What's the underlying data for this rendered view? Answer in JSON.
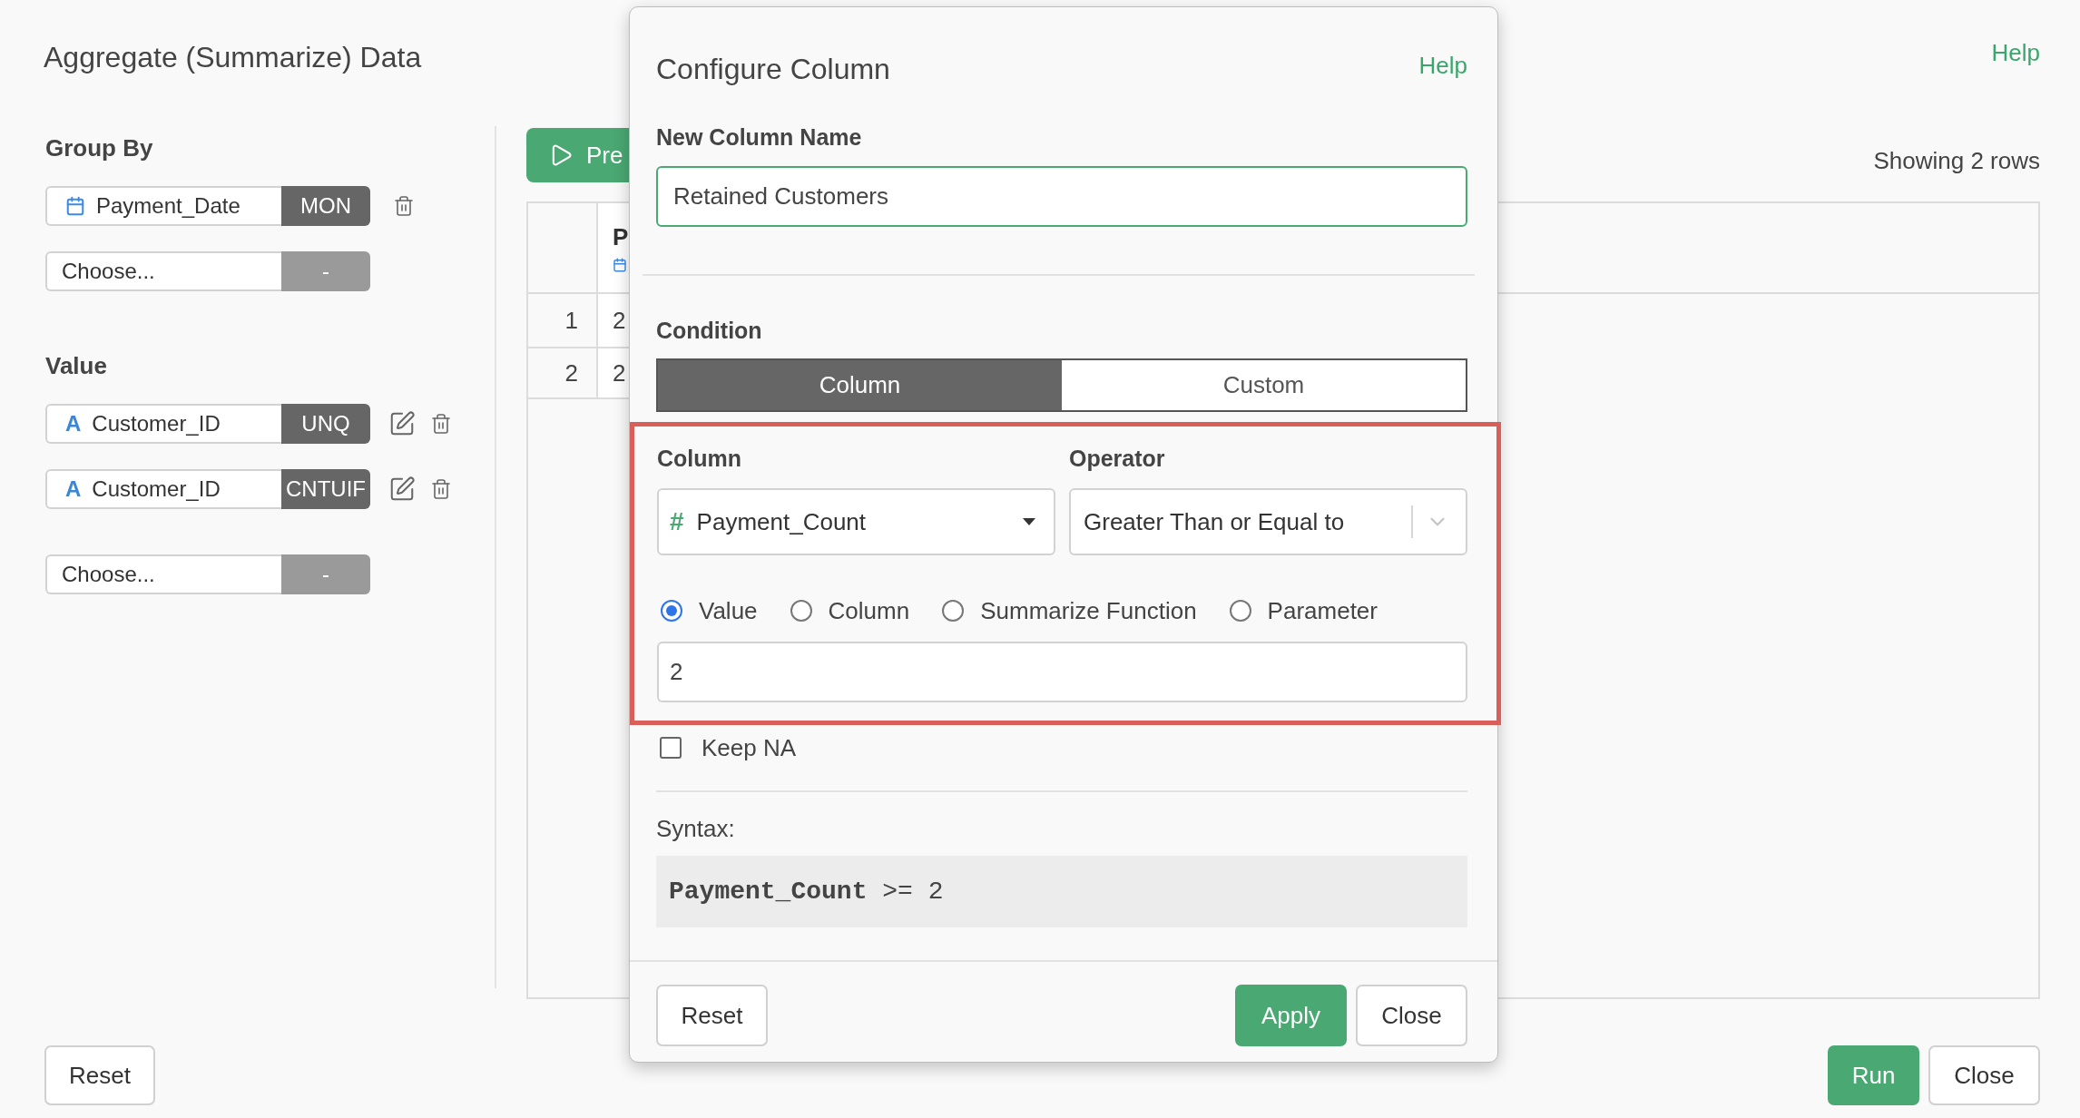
{
  "page": {
    "title": "Aggregate (Summarize) Data",
    "help_link": "Help"
  },
  "group_by": {
    "label": "Group By",
    "items": [
      {
        "kind": "date",
        "column": "Payment_Date",
        "function": "MON",
        "editable": false
      }
    ],
    "chooser": {
      "placeholder": "Choose...",
      "function": "-",
      "disabled": true
    }
  },
  "value": {
    "label": "Value",
    "items": [
      {
        "kind": "text",
        "type_glyph": "A",
        "column": "Customer_ID",
        "function": "UNQ",
        "editable": true
      },
      {
        "kind": "text",
        "type_glyph": "A",
        "column": "Customer_ID",
        "function": "CNTUIF",
        "editable": true
      }
    ],
    "chooser": {
      "placeholder": "Choose...",
      "function": "-",
      "disabled": true
    }
  },
  "preview": {
    "button_label": "Pre",
    "row_count": "Showing 2 rows"
  },
  "table": {
    "columns": [
      {
        "name": "P",
        "kind": "date"
      }
    ],
    "rows": [
      {
        "row_number": "1",
        "cells": [
          "2"
        ]
      },
      {
        "row_number": "2",
        "cells": [
          "2"
        ]
      }
    ]
  },
  "footer": {
    "left": [
      {
        "label": "Reset",
        "kind": "default"
      }
    ],
    "right": [
      {
        "label": "Run",
        "kind": "primary"
      },
      {
        "label": "Close",
        "kind": "default"
      }
    ]
  },
  "dialog": {
    "title": "Configure Column",
    "help_link": "Help",
    "new_column_name": {
      "label": "New Column Name",
      "value": "Retained Customers",
      "focused": true
    },
    "condition": {
      "label": "Condition",
      "tabs": [
        {
          "label": "Column",
          "selected": true
        },
        {
          "label": "Custom",
          "selected": false
        }
      ]
    },
    "condition_rule": {
      "highlighted": true,
      "column_field": {
        "label": "Column",
        "kind": "numeric",
        "type_glyph": "#",
        "value": "Payment_Count"
      },
      "operator_field": {
        "label": "Operator",
        "value": "Greater Than or Equal to"
      },
      "compare_with": [
        {
          "label": "Value",
          "selected": true
        },
        {
          "label": "Column",
          "selected": false
        },
        {
          "label": "Summarize Function",
          "selected": false
        },
        {
          "label": "Parameter",
          "selected": false
        }
      ],
      "value_input": {
        "value": "2"
      }
    },
    "keep_na": {
      "label": "Keep NA",
      "checked": false
    },
    "syntax": {
      "label": "Syntax:",
      "code": "**Payment_Count** >= 2"
    },
    "footer": {
      "left": [
        {
          "label": "Reset",
          "kind": "default"
        }
      ],
      "right": [
        {
          "label": "Apply",
          "kind": "primary"
        },
        {
          "label": "Close",
          "kind": "default"
        }
      ]
    }
  }
}
